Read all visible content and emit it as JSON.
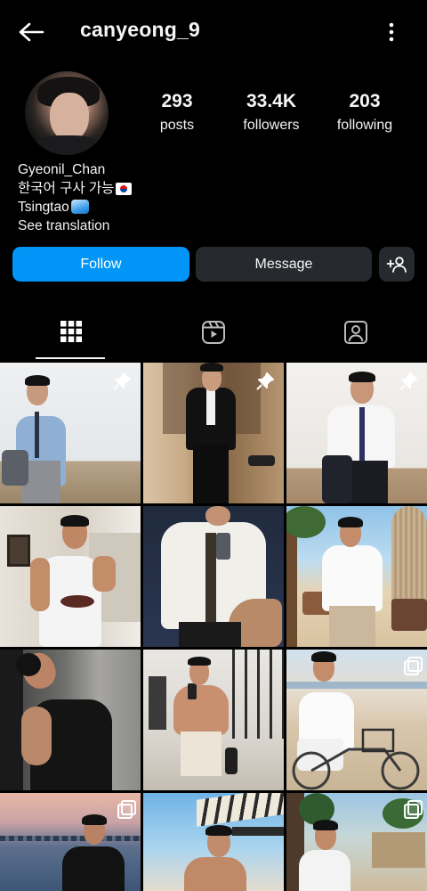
{
  "header": {
    "username": "canyeong_9"
  },
  "profile": {
    "stats": [
      {
        "value": "293",
        "label": "posts"
      },
      {
        "value": "33.4K",
        "label": "followers"
      },
      {
        "value": "203",
        "label": "following"
      }
    ],
    "bio": {
      "name": "Gyeonil_Chan",
      "line2": "한국어 구사 가능",
      "line3": "Tsingtao",
      "see_translation": "See translation"
    }
  },
  "actions": {
    "follow_label": "Follow",
    "message_label": "Message"
  },
  "tabs": [
    {
      "icon": "grid-icon",
      "selected": true
    },
    {
      "icon": "reels-icon",
      "selected": false
    },
    {
      "icon": "tagged-icon",
      "selected": false
    }
  ],
  "posts": [
    {
      "badge": "pin-icon"
    },
    {
      "badge": "pin-icon"
    },
    {
      "badge": "pin-icon"
    },
    {
      "badge": ""
    },
    {
      "badge": ""
    },
    {
      "badge": ""
    },
    {
      "badge": ""
    },
    {
      "badge": ""
    },
    {
      "badge": "multi-icon"
    },
    {
      "badge": "multi-icon"
    },
    {
      "badge": ""
    },
    {
      "badge": "multi-icon"
    }
  ],
  "colors": {
    "background": "#000000",
    "follow_button": "#0095f6",
    "secondary_button": "#262a2e"
  }
}
